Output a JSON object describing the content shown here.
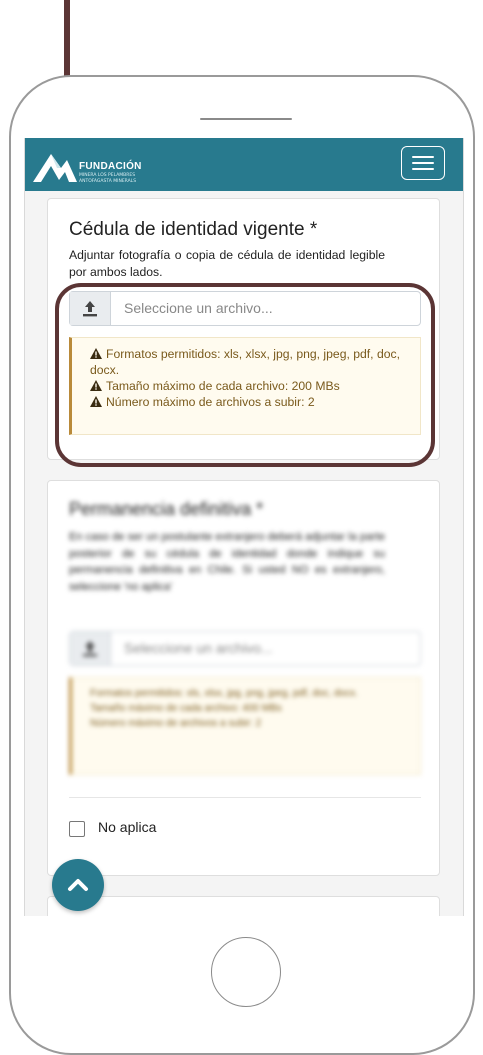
{
  "brand": {
    "name": "FUNDACIÓN",
    "tagline": "MINERA LOS PELAMBRES",
    "sub": "ANTOFAGASTA MINERALS",
    "color": "#287a8e"
  },
  "navbar": {
    "menu_icon": "hamburger-icon"
  },
  "section_id": {
    "title": "Cédula de identidad vigente *",
    "description": "Adjuntar fotografía o copia de cédula de identidad legible por ambos lados.",
    "file_placeholder": "Seleccione un archivo...",
    "upload_icon": "upload-icon",
    "alert": {
      "formats_label": "Formatos permitidos:",
      "formats_value": "xls, xlsx, jpg, png, jpeg, pdf, doc, docx.",
      "max_size": "Tamaño máximo de cada archivo: 200 MBs",
      "max_files": "Número máximo de archivos a subir: 2"
    }
  },
  "section_permanence": {
    "title": "Permanencia definitiva *",
    "description": "En caso de ser un postulante extranjero deberá adjuntar la parte posterior de su cédula de identidad donde indique su permanencia definitiva en Chile. Si usted NO es extranjero, seleccione 'no aplica'",
    "file_placeholder": "Seleccione un archivo...",
    "alert": {
      "formats": "Formatos permitidos: xls, xlsx, jpg, png, jpeg, pdf, doc, docx.",
      "max_size": "Tamaño máximo de cada archivo: 400 MBs",
      "max_files": "Número máximo de archivos a subir: 2"
    },
    "checkbox_label": "No aplica"
  },
  "fab": {
    "icon": "chevron-up-icon"
  },
  "annotation": {
    "color": "#5b3535"
  }
}
